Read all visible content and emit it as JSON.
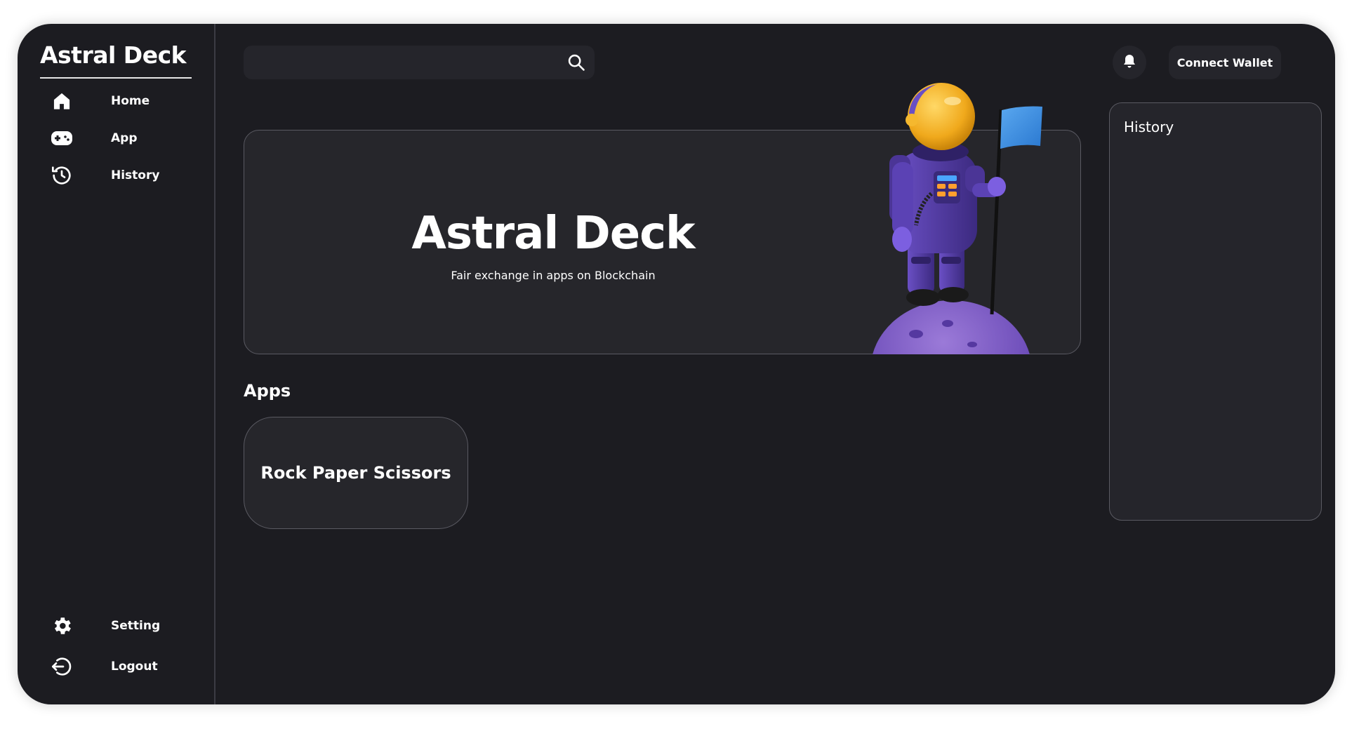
{
  "sidebar": {
    "brand": "Astral Deck",
    "top_items": [
      {
        "label": "Home",
        "icon": "home-icon"
      },
      {
        "label": "App",
        "icon": "gamepad-icon"
      },
      {
        "label": "History",
        "icon": "history-icon"
      }
    ],
    "bottom_items": [
      {
        "label": "Setting",
        "icon": "gear-icon"
      },
      {
        "label": "Logout",
        "icon": "logout-icon"
      }
    ]
  },
  "header": {
    "search_placeholder": "",
    "search_icon": "search-icon",
    "bell_icon": "bell-icon",
    "wallet_label": "Connect Wallet"
  },
  "hero": {
    "title": "Astral Deck",
    "subtitle": "Fair exchange in apps on Blockchain"
  },
  "apps": {
    "heading": "Apps",
    "items": [
      {
        "label": "Rock Paper Scissors"
      }
    ]
  },
  "history_panel": {
    "title": "History"
  },
  "colors": {
    "background": "#1c1c21",
    "card": "#26262b",
    "border": "#5a5a62",
    "text": "#ffffff",
    "flag": "#3b8fe0",
    "helmet": "#f5b82e",
    "suit": "#5a3fb0"
  }
}
